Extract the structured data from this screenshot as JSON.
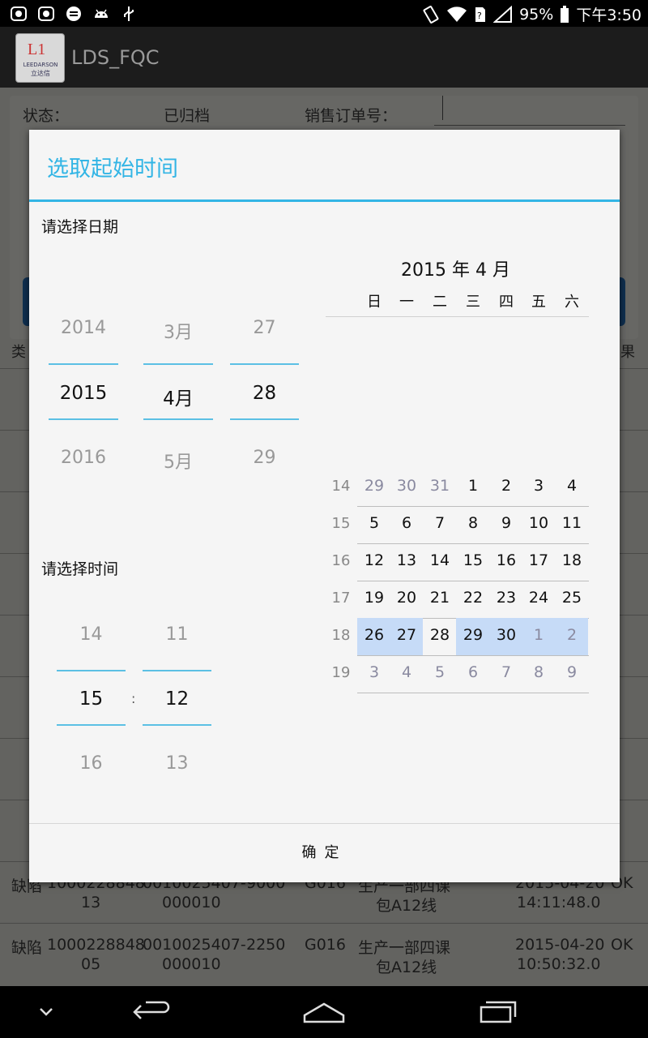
{
  "status_bar": {
    "battery": "95%",
    "time": "下午3:50",
    "left_icons": [
      "notification-icon",
      "notification-icon",
      "sync-icon",
      "android-icon",
      "usb-icon"
    ],
    "right_icons": [
      "vibrate-icon",
      "wifi-icon",
      "sim-icon",
      "signal-icon",
      "battery-icon"
    ]
  },
  "app": {
    "title": "LDS_FQC",
    "logo_mark": "L1",
    "logo_text": "LEEDARSON",
    "logo_cn": "立达信"
  },
  "background": {
    "status_label": "状态：",
    "status_value": "已归档",
    "order_label": "销售订单号：",
    "col_type": "类",
    "col_result": "果",
    "rows": [
      {
        "type": "缺陷",
        "no": "1000228848",
        "no2": "13",
        "order": "0010025407-",
        "order2": "000010",
        "qty": "9000",
        "line": "G016",
        "dept": "生产一部四课",
        "dept2": "包A12线",
        "date": "2015-04-20",
        "time": "14:11:48.0",
        "result": "OK"
      },
      {
        "type": "缺陷",
        "no": "1000228848",
        "no2": "05",
        "order": "0010025407-",
        "order2": "000010",
        "qty": "2250",
        "line": "G016",
        "dept": "生产一部四课",
        "dept2": "包A12线",
        "date": "2015-04-20",
        "time": "10:50:32.0",
        "result": "OK"
      }
    ]
  },
  "dialog": {
    "title": "选取起始时间",
    "date_label": "请选择日期",
    "time_label": "请选择时间",
    "date_picker": {
      "year": {
        "prev": "2014",
        "current": "2015",
        "next": "2016"
      },
      "month": {
        "prev": "3月",
        "current": "4月",
        "next": "5月"
      },
      "day": {
        "prev": "27",
        "current": "28",
        "next": "29"
      }
    },
    "time_picker": {
      "hour": {
        "prev": "14",
        "current": "15",
        "next": "16"
      },
      "minute": {
        "prev": "11",
        "current": "12",
        "next": "13"
      },
      "separator": ":"
    },
    "calendar": {
      "header": "2015 年 4 月",
      "weekdays": [
        "日",
        "一",
        "二",
        "三",
        "四",
        "五",
        "六"
      ],
      "weeks": [
        {
          "num": "14",
          "days": [
            {
              "d": "29",
              "o": true
            },
            {
              "d": "30",
              "o": true
            },
            {
              "d": "31",
              "o": true
            },
            {
              "d": "1"
            },
            {
              "d": "2"
            },
            {
              "d": "3"
            },
            {
              "d": "4"
            }
          ]
        },
        {
          "num": "15",
          "days": [
            {
              "d": "5"
            },
            {
              "d": "6"
            },
            {
              "d": "7"
            },
            {
              "d": "8"
            },
            {
              "d": "9"
            },
            {
              "d": "10"
            },
            {
              "d": "11"
            }
          ]
        },
        {
          "num": "16",
          "days": [
            {
              "d": "12"
            },
            {
              "d": "13"
            },
            {
              "d": "14"
            },
            {
              "d": "15"
            },
            {
              "d": "16"
            },
            {
              "d": "17"
            },
            {
              "d": "18"
            }
          ]
        },
        {
          "num": "17",
          "days": [
            {
              "d": "19"
            },
            {
              "d": "20"
            },
            {
              "d": "21"
            },
            {
              "d": "22"
            },
            {
              "d": "23"
            },
            {
              "d": "24"
            },
            {
              "d": "25"
            }
          ]
        },
        {
          "num": "18",
          "days": [
            {
              "d": "26",
              "s": true
            },
            {
              "d": "27",
              "s": true
            },
            {
              "d": "28",
              "t": true
            },
            {
              "d": "29",
              "s": true
            },
            {
              "d": "30",
              "s": true
            },
            {
              "d": "1",
              "o": true,
              "s": true
            },
            {
              "d": "2",
              "o": true,
              "s": true
            }
          ]
        },
        {
          "num": "19",
          "days": [
            {
              "d": "3",
              "o": true
            },
            {
              "d": "4",
              "o": true
            },
            {
              "d": "5",
              "o": true
            },
            {
              "d": "6",
              "o": true
            },
            {
              "d": "7",
              "o": true
            },
            {
              "d": "8",
              "o": true
            },
            {
              "d": "9",
              "o": true
            }
          ]
        }
      ]
    },
    "confirm_label": "确定"
  },
  "nav": {
    "icons": [
      "chevron-down-icon",
      "back-icon",
      "home-icon",
      "recent-apps-icon"
    ]
  },
  "colors": {
    "accent": "#33b5e5",
    "wheel_line": "#5cc0e4",
    "selected_week": "#c6dbf7"
  }
}
